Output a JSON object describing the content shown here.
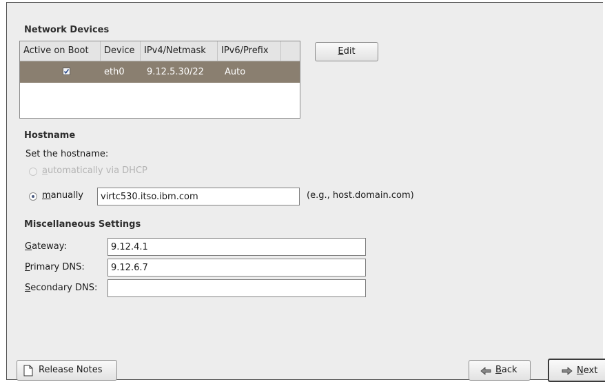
{
  "network_devices": {
    "title": "Network Devices",
    "columns": [
      "Active on Boot",
      "Device",
      "IPv4/Netmask",
      "IPv6/Prefix"
    ],
    "rows": [
      {
        "active_on_boot": true,
        "device": "eth0",
        "ipv4": "9.12.5.30/22",
        "ipv6": "Auto"
      }
    ],
    "edit_button": {
      "label_mnemonic": "E",
      "label_rest": "dit"
    }
  },
  "hostname": {
    "title": "Hostname",
    "prompt": "Set the hostname:",
    "dhcp_option": {
      "label_mnemonic": "a",
      "label_rest": "utomatically via DHCP",
      "enabled": false,
      "selected": false
    },
    "manual_option": {
      "label_mnemonic": "m",
      "label_rest": "anually",
      "selected": true
    },
    "value": "virtc530.itso.ibm.com",
    "hint": "(e.g., host.domain.com)"
  },
  "misc": {
    "title": "Miscellaneous Settings",
    "gateway": {
      "label_mnemonic": "G",
      "label_rest": "ateway:",
      "value": "9.12.4.1"
    },
    "primary_dns": {
      "label_mnemonic": "P",
      "label_rest": "rimary DNS:",
      "value": "9.12.6.7"
    },
    "secondary_dns": {
      "label_mnemonic": "S",
      "label_rest": "econdary DNS:",
      "value": ""
    }
  },
  "footer": {
    "release_notes": "Release Notes",
    "back": {
      "label_mnemonic": "B",
      "label_rest": "ack"
    },
    "next": {
      "label_mnemonic": "N",
      "label_rest": "ext"
    }
  },
  "icons": {
    "release_notes": "document-icon",
    "back": "arrow-left-icon",
    "next": "arrow-right-icon"
  }
}
